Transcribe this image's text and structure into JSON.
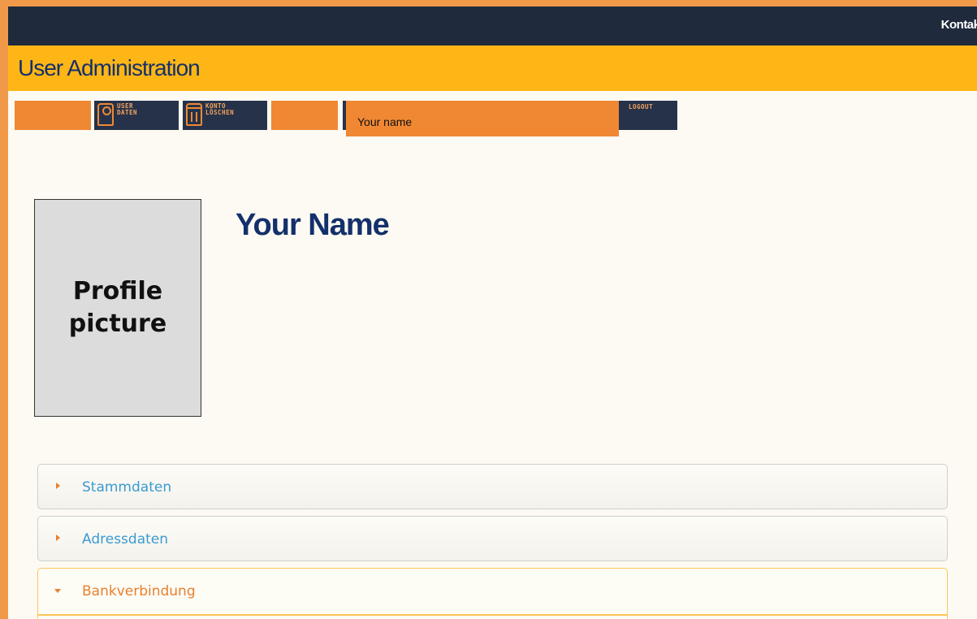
{
  "header": {
    "contact_link": "Kontakt"
  },
  "titlebar": {
    "title": "User Administration"
  },
  "toolbar": {
    "user_data_label": "USER\nDATEN",
    "delete_account_label": "KONTO\nLÖSCHEN",
    "name_field_value": "Your name",
    "logout_label": "LOGOUT"
  },
  "profile": {
    "picture_placeholder": "Profile picture",
    "name": "Your Name"
  },
  "accordion": {
    "sections": [
      {
        "label": "Stammdaten",
        "expanded": false
      },
      {
        "label": "Adressdaten",
        "expanded": false
      },
      {
        "label": "Bankverbindung",
        "expanded": true
      }
    ]
  },
  "colors": {
    "navy": "#1f2a3c",
    "amber": "#fdb616",
    "orange": "#f08833",
    "title_blue": "#14306b",
    "link_blue": "#3a9bd2"
  }
}
